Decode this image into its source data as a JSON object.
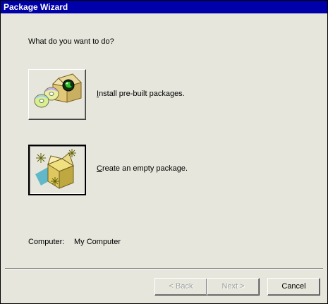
{
  "window": {
    "title": "Package Wizard"
  },
  "prompt": "What do you want to do?",
  "options": [
    {
      "key": "install",
      "label_accel": "I",
      "label_rest": "nstall pre-built packages.",
      "icon": "cd-package-icon",
      "pressed": false
    },
    {
      "key": "create",
      "label_accel": "C",
      "label_rest": "reate an empty package.",
      "icon": "empty-package-icon",
      "pressed": true
    }
  ],
  "computer": {
    "label": "Computer:",
    "value": "My Computer"
  },
  "buttons": {
    "back": "< Back",
    "next": "Next >",
    "cancel": "Cancel"
  },
  "colors": {
    "titlebar": "#0000aa",
    "background": "#e6e6dc"
  }
}
